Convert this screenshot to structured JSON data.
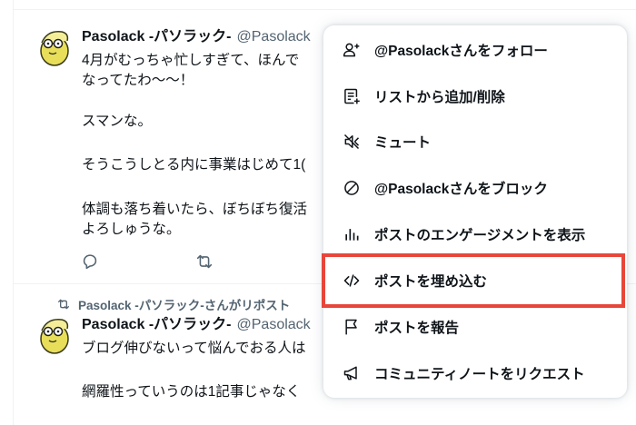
{
  "tweet1": {
    "name": "Pasolack -パソラック-",
    "handle": "@Pasolack",
    "lines": [
      "4月がむっちゃ忙しすぎて、ほんで",
      "なってたわ〜〜！",
      "スマンな。",
      "そうこうしとる内に事業はじめて1(",
      "体調も落ち着いたら、ぼちぼち復活",
      "よろしゅうな。"
    ],
    "actions": [
      "reply-icon",
      "retweet-icon"
    ]
  },
  "tweet2": {
    "retweet_note": "Pasolack -パソラック-さんがリポスト",
    "name": "Pasolack -パソラック-",
    "handle": "@Pasolack",
    "lines": [
      "ブログ伸びないって悩んでおる人は",
      "網羅性っていうのは1記事じゃなく"
    ]
  },
  "menu": {
    "items": [
      {
        "icon": "follow-user-icon",
        "label": "@Pasolackさんをフォロー"
      },
      {
        "icon": "list-add-icon",
        "label": "リストから追加/削除"
      },
      {
        "icon": "mute-icon",
        "label": "ミュート"
      },
      {
        "icon": "block-icon",
        "label": "@Pasolackさんをブロック"
      },
      {
        "icon": "engagement-chart-icon",
        "label": "ポストのエンゲージメントを表示"
      },
      {
        "icon": "embed-code-icon",
        "label": "ポストを埋め込む"
      },
      {
        "icon": "report-flag-icon",
        "label": "ポストを報告"
      },
      {
        "icon": "community-note-icon",
        "label": "コミュニティノートをリクエスト"
      }
    ],
    "highlighted_index": 5
  },
  "colors": {
    "highlight": "#e8463a",
    "secondary_text": "#536471",
    "primary_text": "#0f1419"
  }
}
